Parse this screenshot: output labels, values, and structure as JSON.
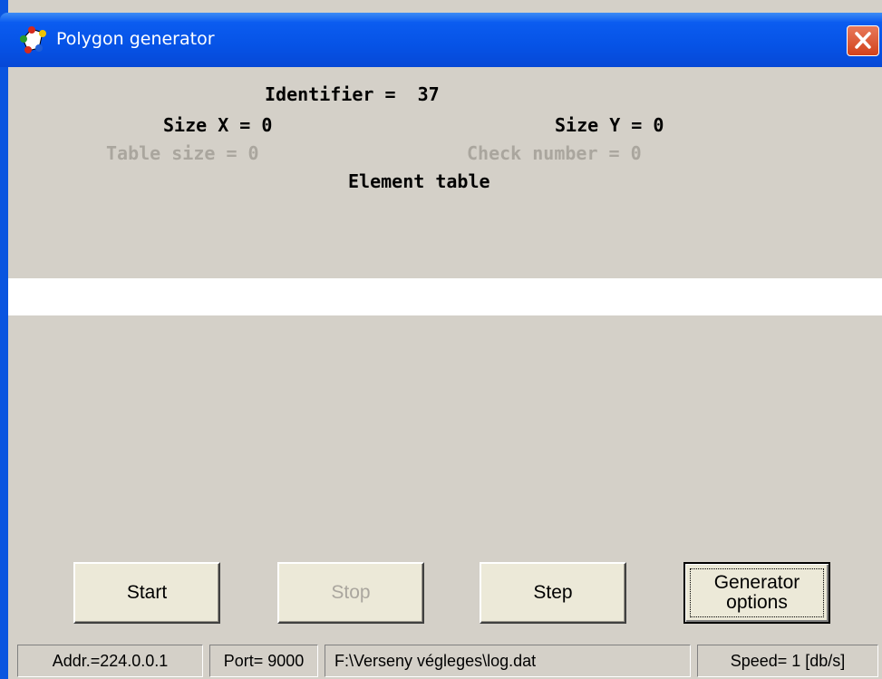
{
  "window": {
    "title": "Polygon generator",
    "icon": "polygon-app-icon",
    "close_icon": "close-icon"
  },
  "info": {
    "identifier": "Identifier =  37",
    "size_x": "Size X = 0",
    "size_y": "Size Y = 0",
    "table_size": "Table size = 0",
    "check_number": "Check number = 0",
    "element_table": "Element table"
  },
  "buttons": {
    "start": "Start",
    "stop": "Stop",
    "step": "Step",
    "generator_options": "Generator options"
  },
  "statusbar": {
    "addr": "Addr.=224.0.0.1",
    "port": "Port= 9000",
    "file": "F:\\Verseny végleges\\log.dat",
    "speed": "Speed= 1 [db/s]"
  },
  "colors": {
    "titlebar": "#0653e6",
    "face": "#d4d0c8",
    "disabled_text": "#aaa69e",
    "close_button": "#d2421c"
  }
}
